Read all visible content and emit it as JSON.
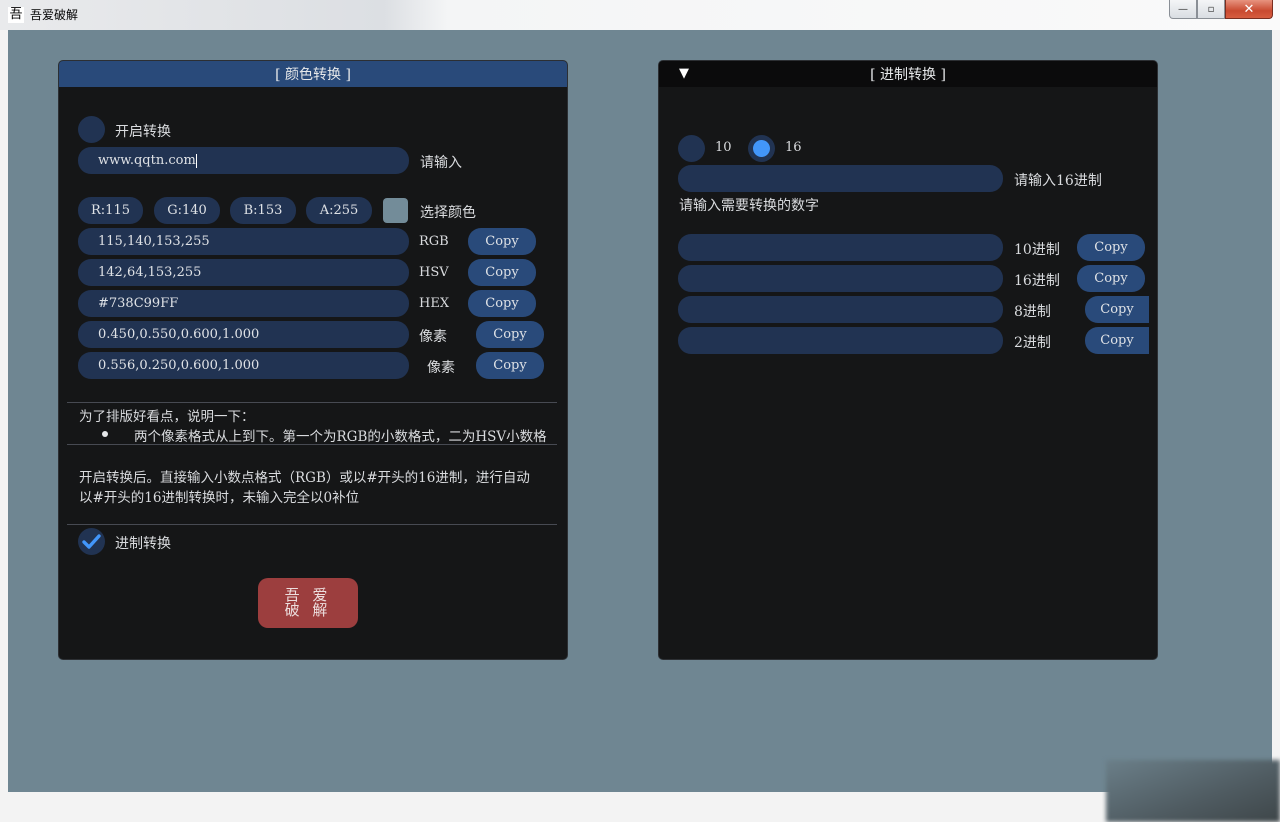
{
  "window": {
    "title": "吾爱破解",
    "icon": "吾",
    "minimize_icon": "—",
    "maximize_icon": "▫",
    "close_icon": "✕"
  },
  "color_panel": {
    "title": "[ 颜色转换 ]",
    "enable_label": "开启转换",
    "enable_checked": false,
    "input_value": "www.qqtn.com",
    "input_label": "请输入",
    "channels": [
      {
        "label": "R:115"
      },
      {
        "label": "G:140"
      },
      {
        "label": "B:153"
      },
      {
        "label": "A:255"
      }
    ],
    "swatch_color": "#738C99",
    "pick_color_label": "选择颜色",
    "outputs": [
      {
        "value": "115,140,153,255",
        "label": "RGB",
        "copy": "Copy"
      },
      {
        "value": "142,64,153,255",
        "label": "HSV",
        "copy": "Copy"
      },
      {
        "value": "#738C99FF",
        "label": "HEX",
        "copy": "Copy"
      },
      {
        "value": "0.450,0.550,0.600,1.000",
        "label": "像素",
        "copy": "Copy"
      },
      {
        "value": "0.556,0.250,0.600,1.000",
        "label": "像素",
        "copy": "Copy"
      }
    ],
    "note_heading": "为了排版好看点，说明一下：",
    "note_bullet": "两个像素格式从上到下。第一个为RGB的小数格式，二为HSV小数格",
    "note_para_1": "开启转换后。直接输入小数点格式（RGB）或以#开头的16进制，进行自动",
    "note_para_2": "以#开头的16进制转换时，未输入完全以0补位",
    "base_toggle_label": "进制转换",
    "base_toggle_checked": true,
    "brand_button": [
      "吾 爱",
      "破 解"
    ]
  },
  "base_panel": {
    "title": "[ 进制转换 ]",
    "collapse_icon": "▼",
    "radio_options": [
      {
        "label": "10",
        "checked": false
      },
      {
        "label": "16",
        "checked": true
      }
    ],
    "input_value": "",
    "input_label": "请输入16进制",
    "hint": "请输入需要转换的数字",
    "outputs": [
      {
        "value": "",
        "label": "10进制",
        "copy": "Copy"
      },
      {
        "value": "",
        "label": "16进制",
        "copy": "Copy"
      },
      {
        "value": "",
        "label": "8进制",
        "copy": "Copy"
      },
      {
        "value": "",
        "label": "2进制",
        "copy": "Copy"
      }
    ]
  }
}
